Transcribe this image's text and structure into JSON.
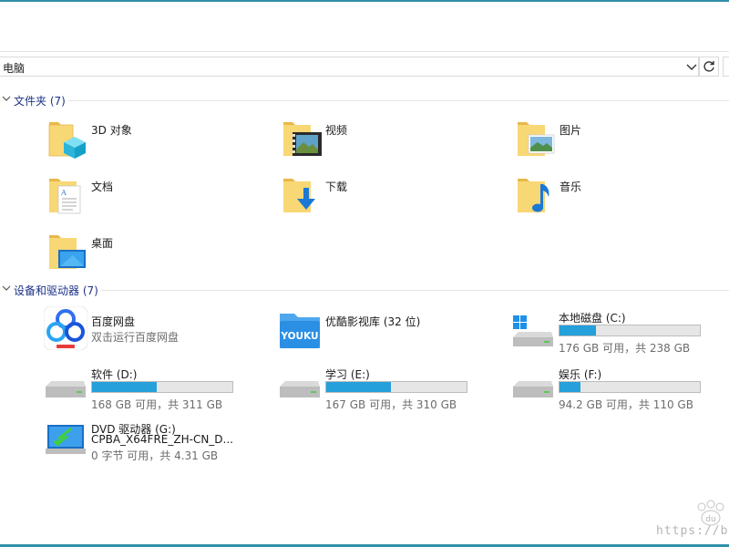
{
  "address": {
    "path": "电脑",
    "separator": "›"
  },
  "groups": {
    "folders": {
      "title": "文件夹 (7)"
    },
    "devices": {
      "title": "设备和驱动器 (7)"
    }
  },
  "folders": [
    {
      "label": "3D 对象",
      "icon": "3d-objects-folder-icon"
    },
    {
      "label": "视频",
      "icon": "videos-folder-icon"
    },
    {
      "label": "图片",
      "icon": "pictures-folder-icon"
    },
    {
      "label": "文档",
      "icon": "documents-folder-icon"
    },
    {
      "label": "下载",
      "icon": "downloads-folder-icon"
    },
    {
      "label": "音乐",
      "icon": "music-folder-icon"
    },
    {
      "label": "桌面",
      "icon": "desktop-folder-icon"
    }
  ],
  "devices": {
    "baidu": {
      "name": "百度网盘",
      "subtitle": "双击运行百度网盘"
    },
    "youku": {
      "name": "优酷影视库 (32 位)",
      "logo_text": "YOUKU"
    },
    "c": {
      "name": "本地磁盘 (C:)",
      "free_text": "176 GB 可用，共 238 GB",
      "used_fraction": 0.26
    },
    "d": {
      "name": "软件 (D:)",
      "free_text": "168 GB 可用，共 311 GB",
      "used_fraction": 0.46
    },
    "e": {
      "name": "学习 (E:)",
      "free_text": "167 GB 可用，共 310 GB",
      "used_fraction": 0.46
    },
    "f": {
      "name": "娱乐 (F:)",
      "free_text": "94.2 GB 可用，共 110 GB",
      "used_fraction": 0.15
    },
    "g": {
      "name": "DVD 驱动器 (G:)",
      "volume": "CPBA_X64FRE_ZH-CN_D...",
      "free_text": "0 字节 可用，共 4.31 GB"
    }
  },
  "watermark": {
    "text": "https://blo",
    "logo_text": "du"
  },
  "colors": {
    "accent": "#26a0da",
    "header_text": "#1e3287",
    "frame": "#2f8fa8",
    "folder": "#f8d775"
  }
}
